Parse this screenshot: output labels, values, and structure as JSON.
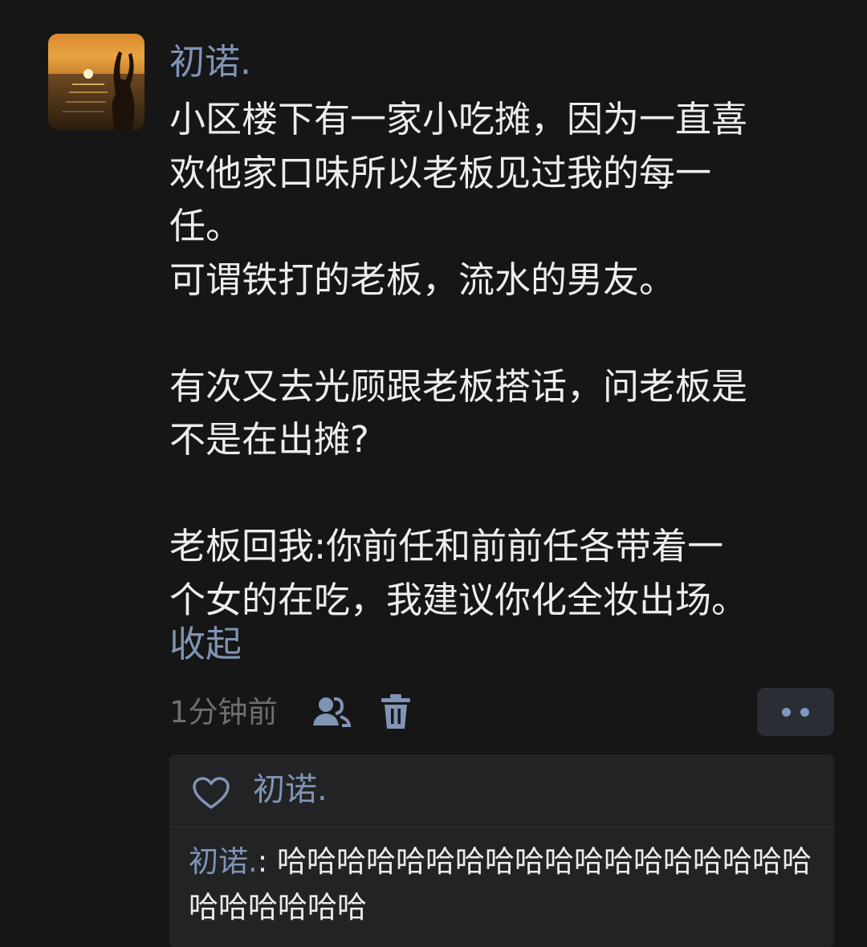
{
  "post": {
    "author": "初诺.",
    "body_lines": [
      "小区楼下有一家小吃摊，因为一直喜",
      "欢他家口味所以老板见过我的每一",
      "任。",
      "可谓铁打的老板，流水的男友。",
      "",
      "有次又去光顾跟老板搭话，问老板是",
      "不是在出摊?",
      "",
      "老板回我:你前任和前前任各带着一",
      "个女的在吃，我建议你化全妆出场。"
    ],
    "collapse_label": "收起",
    "timestamp": "1分钟前",
    "icons": {
      "avatar": "sunset-beach-photo",
      "visibility": "people-icon",
      "delete": "trash-icon",
      "more": "more-dots-icon",
      "like": "heart-icon"
    }
  },
  "likes": {
    "names": "初诺."
  },
  "comments": [
    {
      "author": "初诺.",
      "separator": ": ",
      "text": "哈哈哈哈哈哈哈哈哈哈哈哈哈哈哈哈哈哈哈哈哈哈哈哈"
    }
  ],
  "colors": {
    "background": "#161616",
    "text": "#ececec",
    "link": "#8094b4",
    "muted": "#6f6f6f",
    "panel": "#222325"
  }
}
